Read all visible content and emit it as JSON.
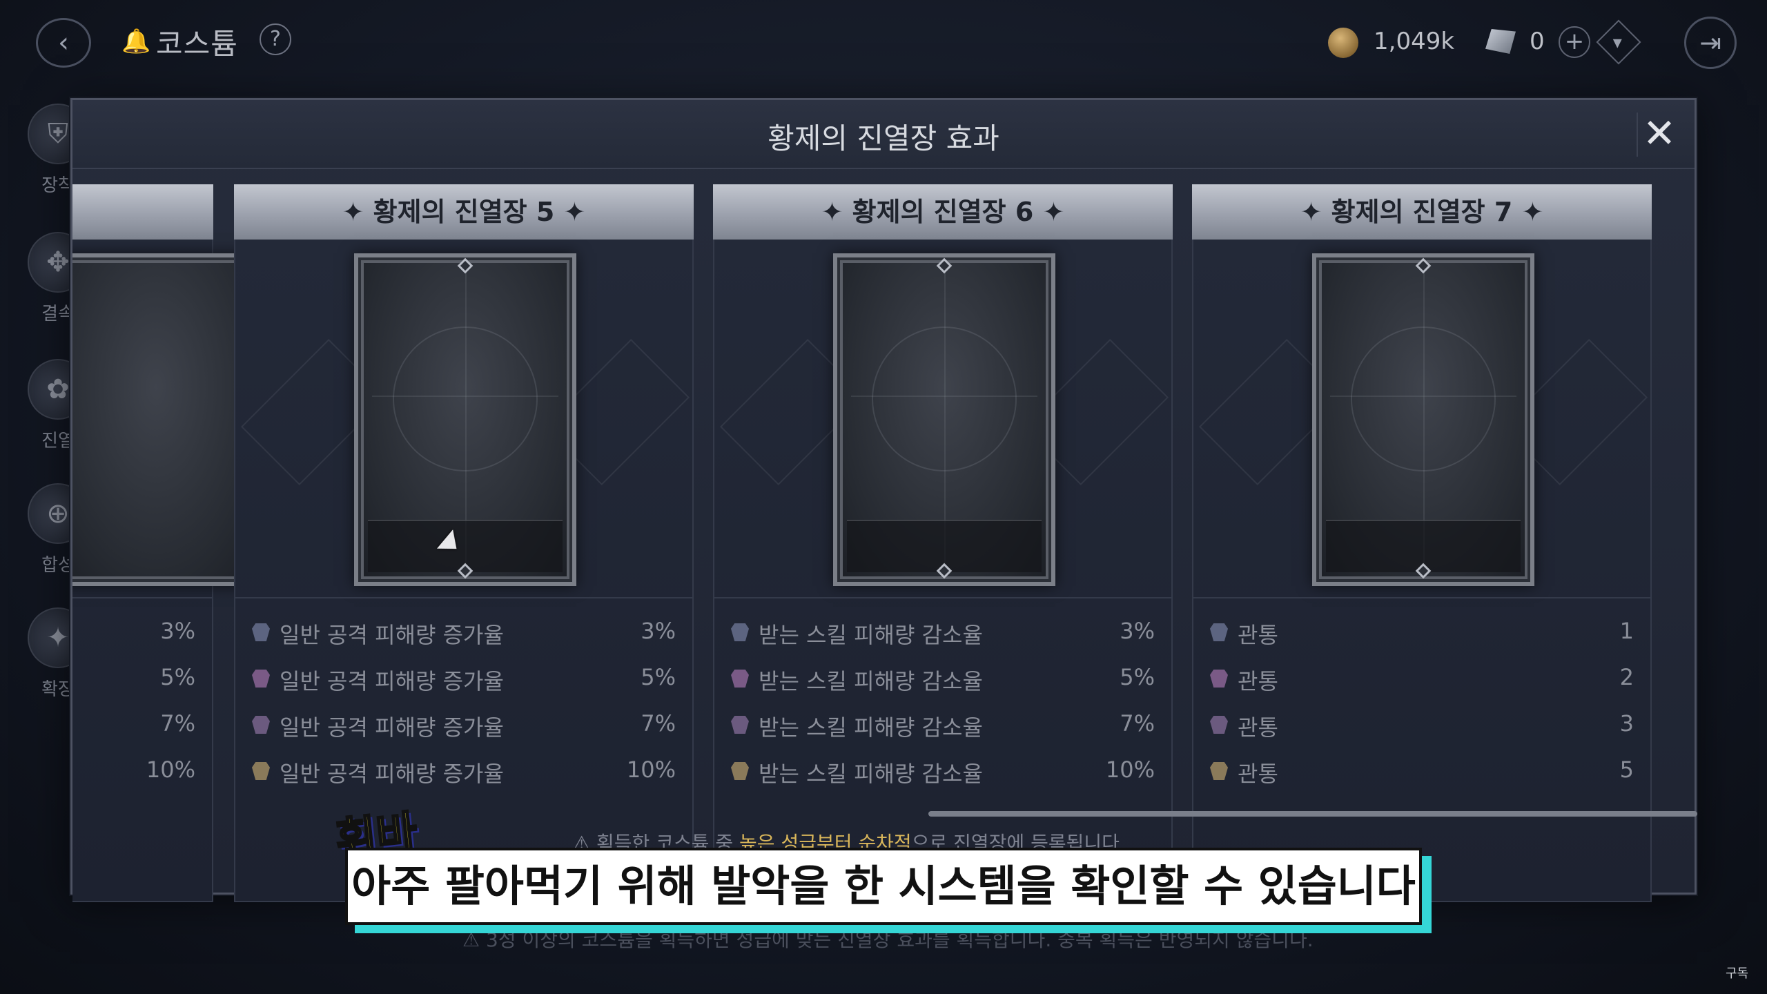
{
  "topbar": {
    "title": "코스튬",
    "help_icon": "?",
    "gold_amount": "1,049k",
    "gem_amount": "0"
  },
  "sidebar": {
    "items": [
      {
        "label": "장착",
        "icon": "helmet-icon"
      },
      {
        "label": "결속",
        "icon": "link-icon"
      },
      {
        "label": "진열",
        "icon": "flower-icon"
      },
      {
        "label": "합성",
        "icon": "synthesis-icon"
      },
      {
        "label": "확장",
        "icon": "expand-icon"
      }
    ]
  },
  "modal": {
    "title": "황제의 진열장 효과",
    "close": "✕"
  },
  "cards": [
    {
      "name": "",
      "stats": [
        {
          "label": "",
          "value": "3%"
        },
        {
          "label": "",
          "value": "5%"
        },
        {
          "label": "",
          "value": "7%"
        },
        {
          "label": "",
          "value": "10%"
        }
      ]
    },
    {
      "name": "황제의 진열장 5",
      "stats": [
        {
          "label": "일반 공격 피해량 증가율",
          "value": "3%"
        },
        {
          "label": "일반 공격 피해량 증가율",
          "value": "5%"
        },
        {
          "label": "일반 공격 피해량 증가율",
          "value": "7%"
        },
        {
          "label": "일반 공격 피해량 증가율",
          "value": "10%"
        }
      ]
    },
    {
      "name": "황제의 진열장 6",
      "stats": [
        {
          "label": "받는 스킬 피해량 감소율",
          "value": "3%"
        },
        {
          "label": "받는 스킬 피해량 감소율",
          "value": "5%"
        },
        {
          "label": "받는 스킬 피해량 감소율",
          "value": "7%"
        },
        {
          "label": "받는 스킬 피해량 감소율",
          "value": "10%"
        }
      ]
    },
    {
      "name": "황제의 진열장 7",
      "stats": [
        {
          "label": "관통",
          "value": "1"
        },
        {
          "label": "관통",
          "value": "2"
        },
        {
          "label": "관통",
          "value": "3"
        },
        {
          "label": "관통",
          "value": "5"
        }
      ]
    }
  ],
  "notes": {
    "note1_prefix": "획득한 코스튬 중 ",
    "note1_highlight": "높은 성급부터 순차적",
    "note1_suffix": "으로 진열장에 등록됩니다",
    "note2": "3성 이상의 코스튬을 획득하면 성급에 맞는 진열장 효과를 획득합니다. 중복 획득은 반영되지 않습니다."
  },
  "overlay": {
    "tag": "휘바",
    "subtitle": "아주 팔아먹기 위해 발악을 한 시스템을 확인할 수 있습니다",
    "subscribe": "구독"
  }
}
